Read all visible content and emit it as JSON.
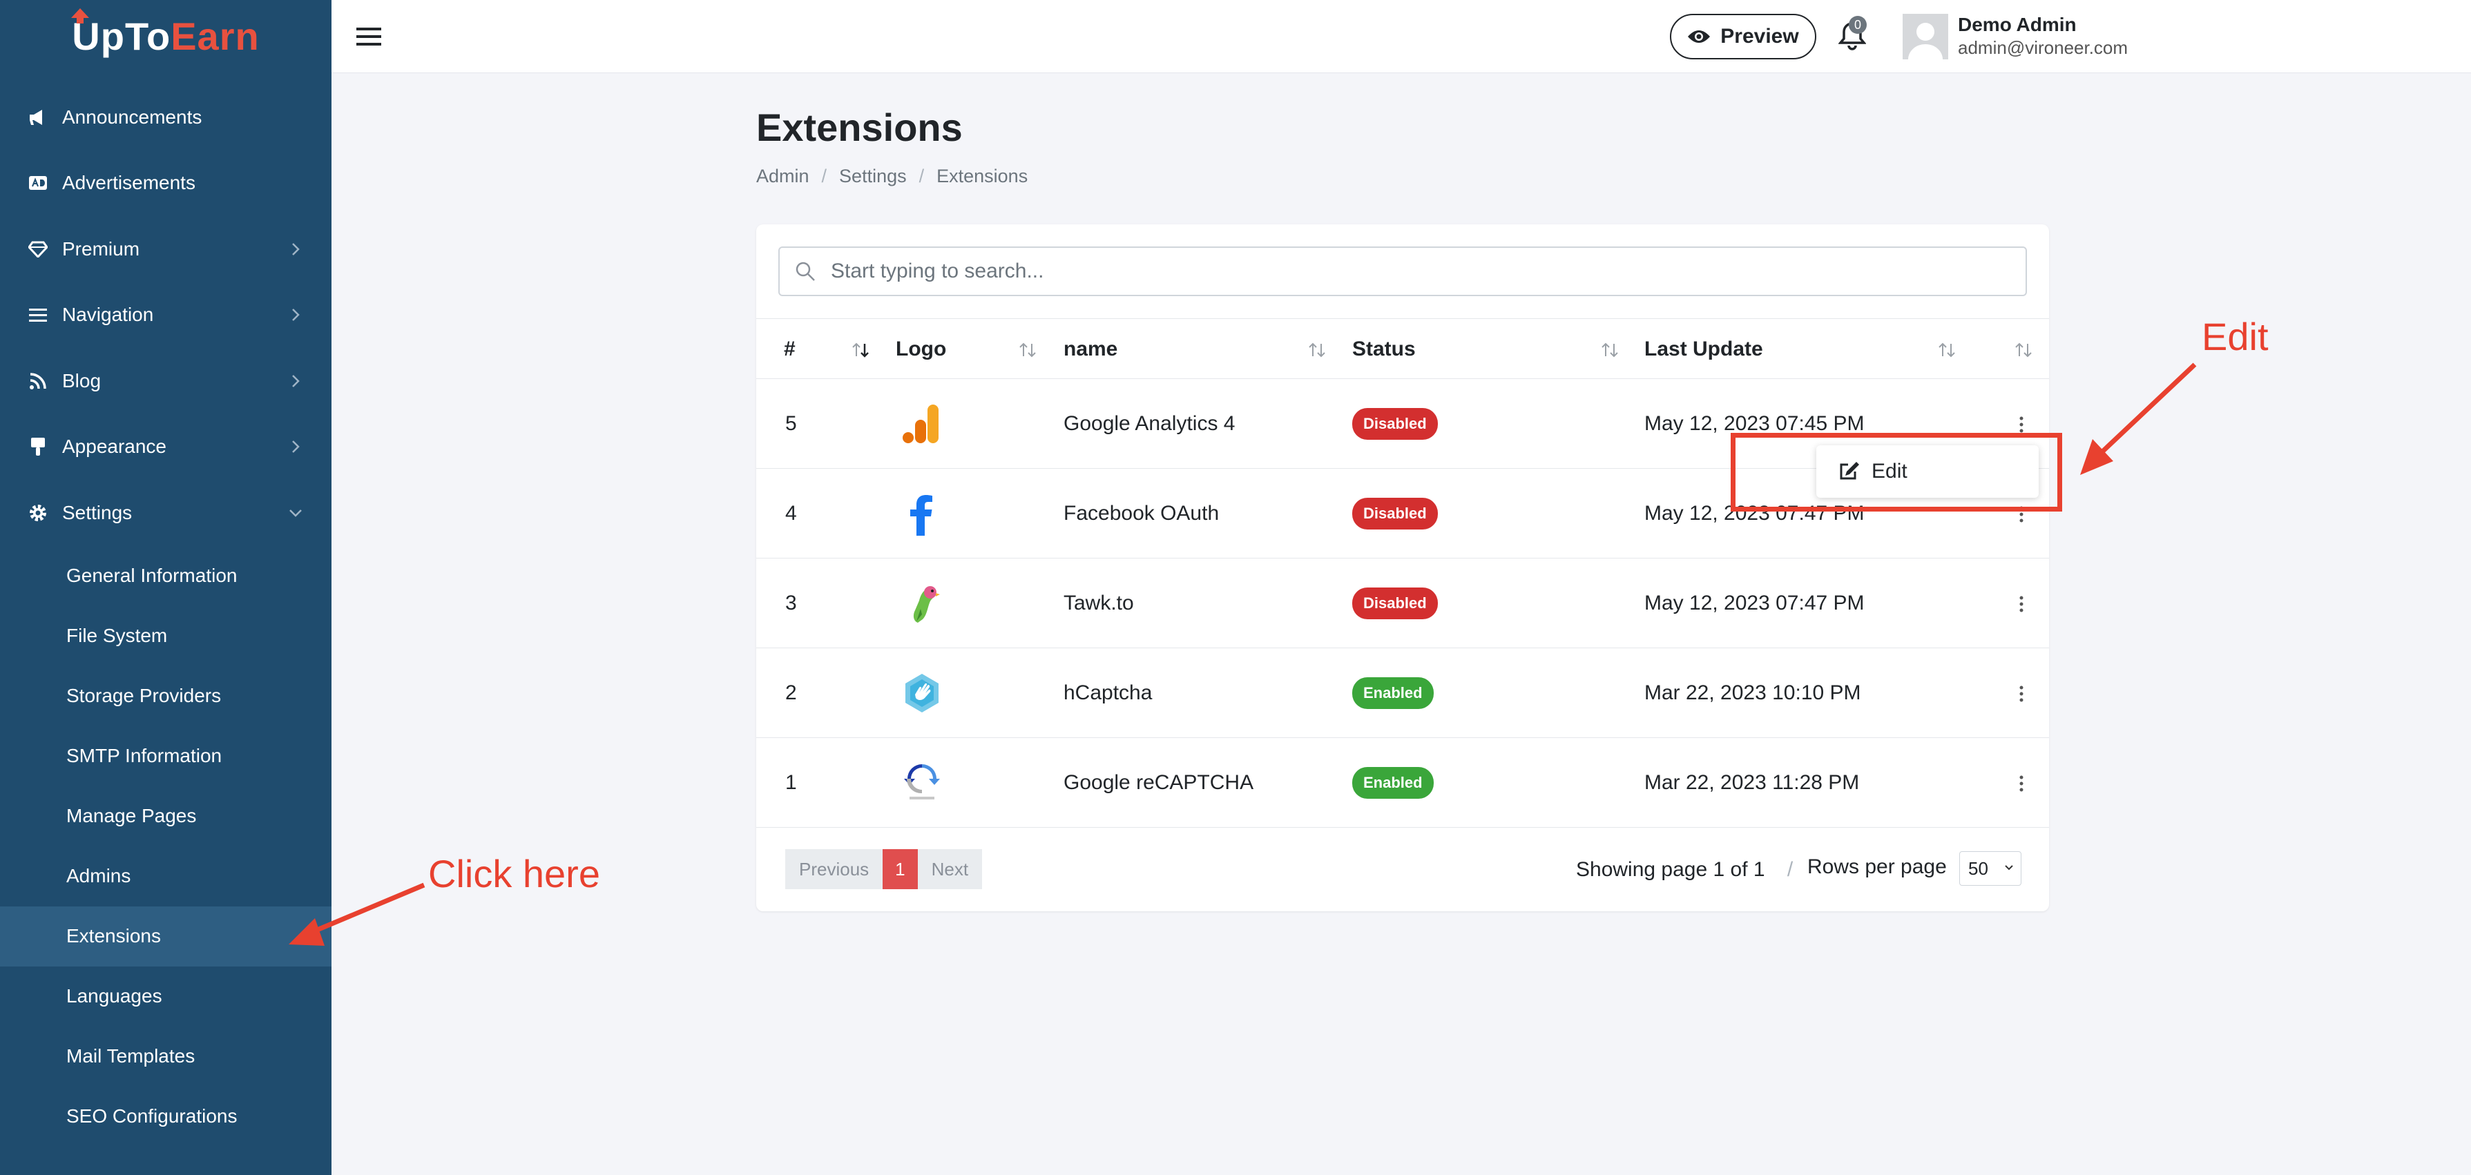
{
  "brand": {
    "part1": "UpTo",
    "part2": "Earn",
    "accent": "#e8513f"
  },
  "sidebar": {
    "items": [
      {
        "label": "Announcements",
        "icon": "megaphone-icon"
      },
      {
        "label": "Advertisements",
        "icon": "ad-icon"
      },
      {
        "label": "Premium",
        "icon": "diamond-icon",
        "expandable": true
      },
      {
        "label": "Navigation",
        "icon": "list-icon",
        "expandable": true
      },
      {
        "label": "Blog",
        "icon": "rss-icon",
        "expandable": true
      },
      {
        "label": "Appearance",
        "icon": "brush-icon",
        "expandable": true
      },
      {
        "label": "Settings",
        "icon": "gear-icon",
        "expanded": true
      }
    ],
    "settings_sub": [
      "General Information",
      "File System",
      "Storage Providers",
      "SMTP Information",
      "Manage Pages",
      "Admins",
      "Extensions",
      "Languages",
      "Mail Templates",
      "SEO Configurations"
    ],
    "active_sub": "Extensions"
  },
  "topbar": {
    "preview_label": "Preview",
    "notification_count": "0",
    "user_name": "Demo Admin",
    "user_email": "admin@vironeer.com"
  },
  "page": {
    "title": "Extensions",
    "breadcrumb": [
      "Admin",
      "Settings",
      "Extensions"
    ]
  },
  "search": {
    "placeholder": "Start typing to search..."
  },
  "table": {
    "columns": [
      "#",
      "Logo",
      "name",
      "Status",
      "Last Update"
    ],
    "rows": [
      {
        "id": "5",
        "logo": "google-analytics-logo",
        "name": "Google Analytics 4",
        "status": "Disabled",
        "updated": "May 12, 2023 07:45 PM"
      },
      {
        "id": "4",
        "logo": "facebook-logo",
        "name": "Facebook OAuth",
        "status": "Disabled",
        "updated": "May 12, 2023 07:47 PM"
      },
      {
        "id": "3",
        "logo": "tawkto-logo",
        "name": "Tawk.to",
        "status": "Disabled",
        "updated": "May 12, 2023 07:47 PM"
      },
      {
        "id": "2",
        "logo": "hcaptcha-logo",
        "name": "hCaptcha",
        "status": "Enabled",
        "updated": "Mar 22, 2023 10:10 PM"
      },
      {
        "id": "1",
        "logo": "recaptcha-logo",
        "name": "Google reCAPTCHA",
        "status": "Enabled",
        "updated": "Mar 22, 2023 11:28 PM"
      }
    ]
  },
  "row_menu": {
    "edit_label": "Edit"
  },
  "pagination": {
    "previous": "Previous",
    "current": "1",
    "next": "Next",
    "showing": "Showing page 1 of 1",
    "separator": "/",
    "rows_per_page_label": "Rows per page",
    "rows_per_page": "50"
  },
  "annotations": {
    "edit": "Edit",
    "click_here": "Click here",
    "color": "#e8412f"
  }
}
